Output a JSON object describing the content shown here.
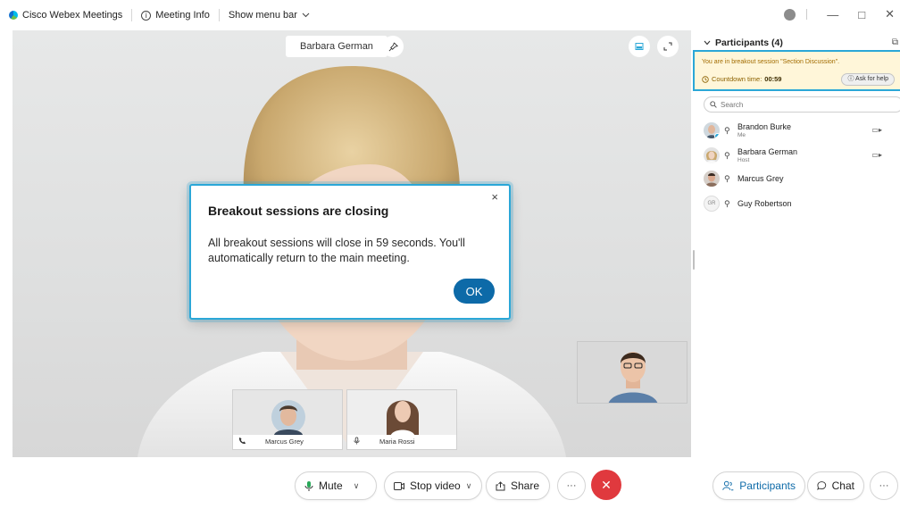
{
  "titlebar": {
    "app_name": "Cisco Webex Meetings",
    "meeting_info": "Meeting Info",
    "show_menu_bar": "Show menu bar"
  },
  "stage": {
    "active_speaker": "Barbara German"
  },
  "dialog": {
    "title": "Breakout sessions are closing",
    "message": "All breakout sessions will close in 59 seconds. You'll automatically return to the main meeting.",
    "ok_label": "OK",
    "close_glyph": "×"
  },
  "thumbnails": [
    {
      "name": "Marcus Grey"
    },
    {
      "name": "Maria Rossi"
    }
  ],
  "controls": {
    "mute": "Mute",
    "stop_video": "Stop video",
    "share": "Share",
    "more": "···"
  },
  "sidebar": {
    "title": "Participants (4)",
    "breakout_notice": "You are in breakout session \"Section Discussion\".",
    "countdown_label": "Countdown time:",
    "countdown_value": "00:59",
    "ask_help": "Ask for help",
    "search_placeholder": "Search",
    "participants": [
      {
        "name": "Brandon Burke",
        "role": "Me",
        "initials": ""
      },
      {
        "name": "Barbara German",
        "role": "Host",
        "initials": ""
      },
      {
        "name": "Marcus Grey",
        "role": "",
        "initials": ""
      },
      {
        "name": "Guy Robertson",
        "role": "",
        "initials": "GR"
      }
    ]
  },
  "side_footer": {
    "participants": "Participants",
    "chat": "Chat",
    "more": "···"
  },
  "colors": {
    "accent": "#2ba7d7",
    "ok_button": "#0d6aa8",
    "end_call": "#e0393e",
    "banner": "#fff6d9"
  }
}
